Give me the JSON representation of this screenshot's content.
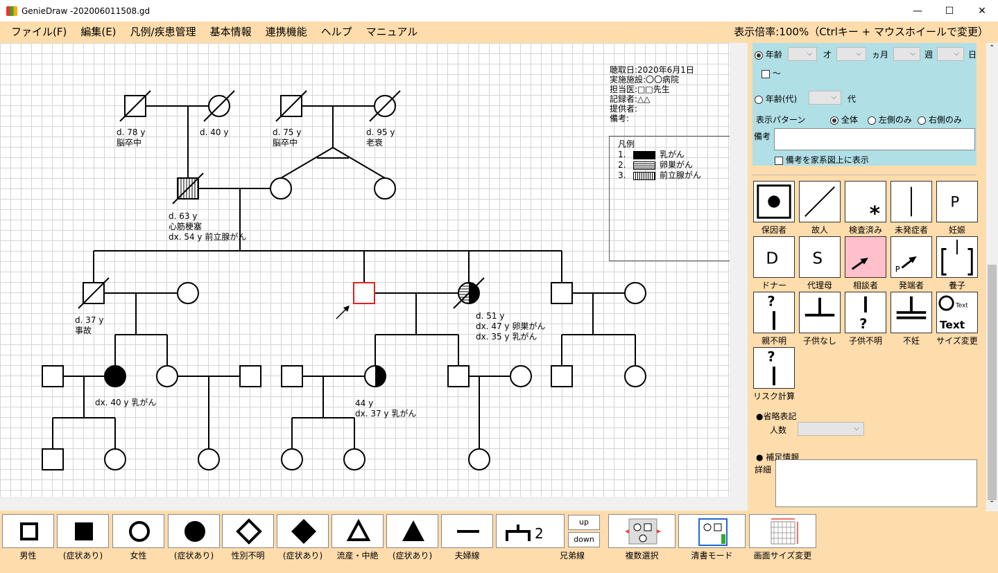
{
  "window": {
    "title": "GenieDraw -202006011508.gd",
    "minimize": "—",
    "maximize": "☐",
    "close": "✕"
  },
  "menu": [
    "ファイル(F)",
    "編集(E)",
    "凡例/疾患管理",
    "基本情報",
    "連携機能",
    "ヘルプ",
    "マニュアル"
  ],
  "zoom_info": "表示倍率:100%（Ctrlキー + マウスホイールで変更）",
  "info": [
    "聴取日:2020年6月1日",
    "実施施設:〇〇病院",
    "担当医:□□先生",
    "記録者:△△",
    "提供者:",
    "備考:"
  ],
  "legend": {
    "title": "凡例",
    "items": [
      {
        "num": "1.",
        "label": "乳がん",
        "pattern": "solid"
      },
      {
        "num": "2.",
        "label": "卵巣がん",
        "pattern": "horizontal-stripes"
      },
      {
        "num": "3.",
        "label": "前立腺がん",
        "pattern": "vertical-stripes"
      }
    ]
  },
  "pedigree_labels": {
    "pgf": [
      "d. 78 y",
      "脳卒中"
    ],
    "pgm": [
      "d. 40 y"
    ],
    "mgf": [
      "d. 75 y",
      "脳卒中"
    ],
    "mgm": [
      "d. 95 y",
      "老衰"
    ],
    "father": [
      "d. 63 y",
      "心筋梗塞",
      "dx. 54 y 前立腺がん"
    ],
    "uncle": [
      "d. 37 y",
      "事故"
    ],
    "wife": [
      "d. 51 y",
      "dx. 47 y 卵巣がん",
      "dx. 35 y 乳がん"
    ],
    "cousin": [
      "dx. 40 y 乳がん"
    ],
    "daughter": [
      "44 y",
      "dx. 37 y 乳がん"
    ]
  },
  "proband_color": "#e02020",
  "age_panel": {
    "age_label": "年齢",
    "units": [
      "才",
      "ヵ月",
      "週",
      "日"
    ],
    "range_mark": "～",
    "age_decade_label": "年齢(代)",
    "decade_unit": "代",
    "pattern_label": "表示パターン",
    "patterns": [
      "全体",
      "左側のみ",
      "右側のみ"
    ],
    "selected_pattern": "全体",
    "note_label": "備考",
    "note_value": "",
    "show_note_label": "備考を家系図上に表示"
  },
  "palette": [
    {
      "label": "保因者",
      "icon": "carrier-icon"
    },
    {
      "label": "故人",
      "icon": "deceased-slash-icon"
    },
    {
      "label": "検査済み",
      "icon": "tested-asterisk-icon"
    },
    {
      "label": "未発症者",
      "icon": "presymptomatic-line-icon"
    },
    {
      "label": "妊娠",
      "icon": "pregnancy-p-icon"
    },
    {
      "label": "ドナー",
      "icon": "donor-d-icon"
    },
    {
      "label": "代理母",
      "icon": "surrogate-s-icon"
    },
    {
      "label": "相談者",
      "icon": "consultand-arrow-icon"
    },
    {
      "label": "発端者",
      "icon": "proband-p-arrow-icon"
    },
    {
      "label": "養子",
      "icon": "adopted-bracket-icon"
    },
    {
      "label": "親不明",
      "icon": "unknown-parent-icon"
    },
    {
      "label": "子供なし",
      "icon": "no-children-icon"
    },
    {
      "label": "子供不明",
      "icon": "unknown-children-icon"
    },
    {
      "label": "不妊",
      "icon": "infertile-icon"
    },
    {
      "label": "サイズ変更",
      "icon": "resize-text-icon"
    },
    {
      "label": "リスク計算",
      "icon": "risk-calc-icon"
    }
  ],
  "abbrev": {
    "title": "●省略表記",
    "count_label": "人数",
    "count_value": ""
  },
  "supplement": {
    "title": "● 補足情報",
    "detail_label": "詳細",
    "detail_value": ""
  },
  "toolbar": [
    {
      "label": "男性"
    },
    {
      "label": "(症状あり)"
    },
    {
      "label": "女性"
    },
    {
      "label": "(症状あり)"
    },
    {
      "label": "性別不明"
    },
    {
      "label": "(症状あり)"
    },
    {
      "label": "流産・中絶"
    },
    {
      "label": "(症状あり)"
    },
    {
      "label": "夫婦線"
    },
    {
      "label": "兄弟線",
      "glyph": "2"
    },
    {
      "label": "複数選択"
    },
    {
      "label": "清書モード"
    },
    {
      "label": "画面サイズ変更"
    }
  ],
  "sibling_buttons": {
    "up": "up",
    "down": "down"
  }
}
